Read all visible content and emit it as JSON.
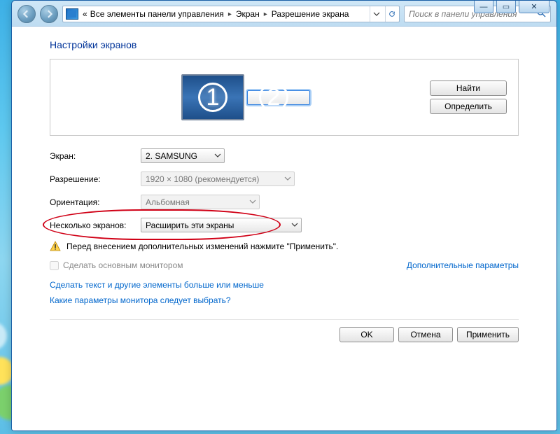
{
  "titlebar": {
    "min": "—",
    "max": "▭",
    "close": "✕"
  },
  "breadcrumb": {
    "prefix": "«",
    "items": [
      "Все элементы панели управления",
      "Экран",
      "Разрешение экрана"
    ]
  },
  "search": {
    "placeholder": "Поиск в панели управления"
  },
  "page": {
    "heading": "Настройки экранов",
    "find_btn": "Найти",
    "identify_btn": "Определить",
    "monitor_numbers": [
      "1",
      "2"
    ]
  },
  "form": {
    "screen_label": "Экран:",
    "screen_value": "2. SAMSUNG",
    "resolution_label": "Разрешение:",
    "resolution_value": "1920 × 1080 (рекомендуется)",
    "orientation_label": "Ориентация:",
    "orientation_value": "Альбомная",
    "multi_label": "Несколько экранов:",
    "multi_value": "Расширить эти экраны",
    "warn_text": "Перед внесением дополнительных изменений нажмите \"Применить\".",
    "primary_checkbox": "Сделать основным монитором",
    "advanced_link": "Дополнительные параметры",
    "link1": "Сделать текст и другие элементы больше или меньше",
    "link2": "Какие параметры монитора следует выбрать?"
  },
  "actions": {
    "ok": "OK",
    "cancel": "Отмена",
    "apply": "Применить"
  }
}
